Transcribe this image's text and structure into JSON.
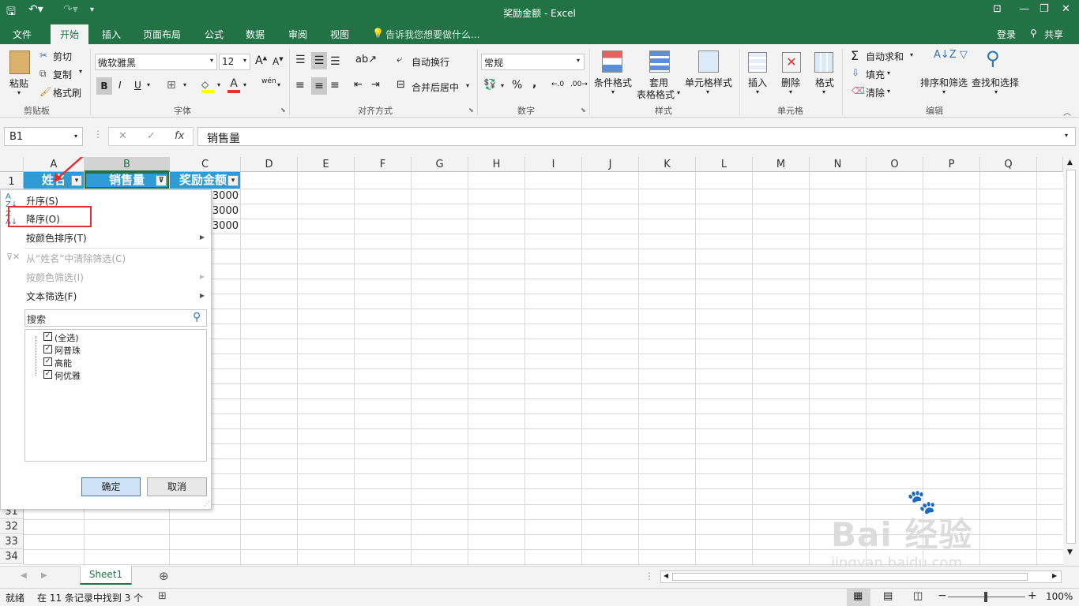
{
  "title": "奖励金额 - Excel",
  "tabs": [
    "文件",
    "开始",
    "插入",
    "页面布局",
    "公式",
    "数据",
    "审阅",
    "视图"
  ],
  "tell_me": "告诉我您想要做什么...",
  "login": "登录",
  "share": "共享",
  "ribbon": {
    "paste": "粘贴",
    "cut": "剪切",
    "copy": "复制",
    "format_painter": "格式刷",
    "clipboard": "剪贴板",
    "font_name": "微软雅黑",
    "font_size": "12",
    "font_group": "字体",
    "bold": "B",
    "italic": "I",
    "underline": "U",
    "wrap": "自动换行",
    "merge": "合并后居中",
    "align_group": "对齐方式",
    "number_format": "常规",
    "number_group": "数字",
    "percent": "%",
    "comma": ",",
    "cond_format": "条件格式",
    "table_format_1": "套用",
    "table_format_2": "表格格式",
    "cell_style": "单元格样式",
    "style_group": "样式",
    "insert": "插入",
    "delete": "删除",
    "format": "格式",
    "cells_group": "单元格",
    "autosum": "自动求和",
    "fill": "填充",
    "clear": "清除",
    "sort_filter": "排序和筛选",
    "find_select": "查找和选择",
    "edit_group": "编辑"
  },
  "formula_bar": {
    "name_box": "B1",
    "fx": "fx",
    "content": "销售量"
  },
  "columns": [
    "A",
    "B",
    "C",
    "D",
    "E",
    "F",
    "G",
    "H",
    "I",
    "J",
    "K",
    "L",
    "M",
    "N",
    "O",
    "P",
    "Q"
  ],
  "rows_top": [
    "1"
  ],
  "rows_bottom": [
    "31",
    "32",
    "33",
    "34"
  ],
  "header_cells": [
    "姓名",
    "销售量",
    "奖励金额"
  ],
  "c_values": [
    "3000",
    "3000",
    "3000"
  ],
  "dropdown": {
    "sort_asc": "升序(S)",
    "sort_desc": "降序(O)",
    "sort_color": "按颜色排序(T)",
    "clear_filter": "从“姓名”中清除筛选(C)",
    "filter_color": "按颜色筛选(I)",
    "text_filter": "文本筛选(F)",
    "search_placeholder": "搜索",
    "items": [
      "(全选)",
      "阿普珠",
      "高能",
      "何优雅"
    ],
    "ok": "确定",
    "cancel": "取消"
  },
  "sheet_tab": "Sheet1",
  "status": {
    "ready": "就绪",
    "found": "在 11 条记录中找到 3 个",
    "zoom": "100%"
  },
  "watermark": {
    "brand": "Bai 经验",
    "url": "jingyan.baidu.com"
  },
  "colors": {
    "excel_green": "#217346",
    "header_blue": "#2e9bd6",
    "annotation_red": "#e03030"
  }
}
